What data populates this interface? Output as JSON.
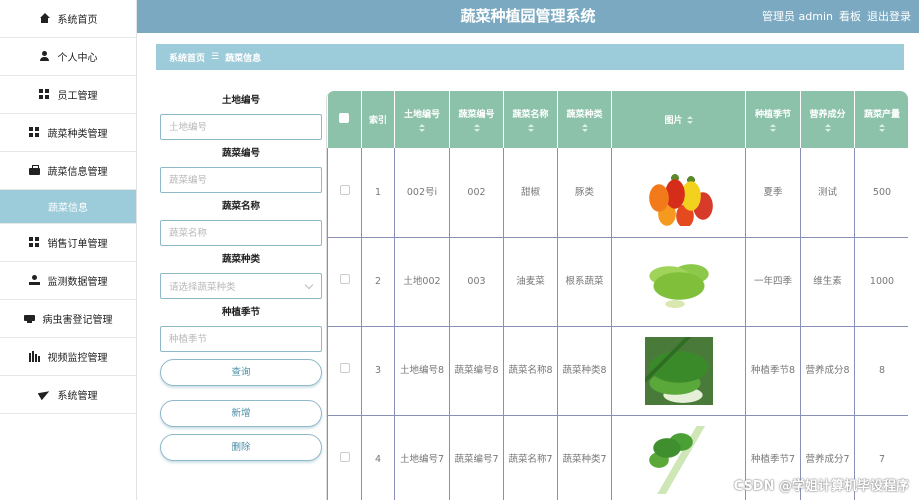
{
  "header": {
    "title": "蔬菜种植园管理系统",
    "user_label": "管理员 admin",
    "dashboard_label": "看板",
    "logout_label": "退出登录"
  },
  "sidebar": {
    "items": [
      {
        "label": "系统首页",
        "icon": "home-icon"
      },
      {
        "label": "个人中心",
        "icon": "user-icon"
      },
      {
        "label": "员工管理",
        "icon": "grid-icon"
      },
      {
        "label": "蔬菜种类管理",
        "icon": "grid-icon"
      },
      {
        "label": "蔬菜信息管理",
        "icon": "briefcase-icon"
      },
      {
        "label": "蔬菜信息",
        "icon": ""
      },
      {
        "label": "销售订单管理",
        "icon": "grid-icon"
      },
      {
        "label": "监测数据管理",
        "icon": "person-icon"
      },
      {
        "label": "病虫害登记管理",
        "icon": "card-icon"
      },
      {
        "label": "视频监控管理",
        "icon": "chart-icon"
      },
      {
        "label": "系统管理",
        "icon": "send-icon"
      }
    ]
  },
  "breadcrumb": {
    "home": "系统首页",
    "separator": "☰",
    "current": "蔬菜信息"
  },
  "search": {
    "land_label": "土地编号",
    "land_placeholder": "土地编号",
    "veg_no_label": "蔬菜编号",
    "veg_no_placeholder": "蔬菜编号",
    "veg_name_label": "蔬菜名称",
    "veg_name_placeholder": "蔬菜名称",
    "veg_type_label": "蔬菜种类",
    "veg_type_placeholder": "请选择蔬菜种类",
    "season_label": "种植季节",
    "season_placeholder": "种植季节",
    "query_button": "查询",
    "add_button": "新增",
    "delete_button": "删除"
  },
  "table": {
    "headers": {
      "index": "索引",
      "land_no": "土地编号",
      "veg_no": "蔬菜编号",
      "veg_name": "蔬菜名称",
      "veg_type": "蔬菜种类",
      "image": "图片",
      "season": "种植季节",
      "nutrition": "营养成分",
      "yield": "蔬菜产量"
    },
    "rows": [
      {
        "index": "1",
        "land_no": "002号i",
        "veg_no": "002",
        "veg_name": "甜椒",
        "veg_type": "豚类",
        "image": "pepper",
        "season": "夏季",
        "nutrition": "测试",
        "yield": "500"
      },
      {
        "index": "2",
        "land_no": "土地002",
        "veg_no": "003",
        "veg_name": "油麦菜",
        "veg_type": "根系蔬菜",
        "image": "lettuce",
        "season": "一年四季",
        "nutrition": "维生素",
        "yield": "1000"
      },
      {
        "index": "3",
        "land_no": "土地编号8",
        "veg_no": "蔬菜编号8",
        "veg_name": "蔬菜名称8",
        "veg_type": "蔬菜种类8",
        "image": "choy",
        "season": "种植季节8",
        "nutrition": "营养成分8",
        "yield": "8"
      },
      {
        "index": "4",
        "land_no": "土地编号7",
        "veg_no": "蔬菜编号7",
        "veg_name": "蔬菜名称7",
        "veg_type": "蔬菜种类7",
        "image": "cilantro",
        "season": "种植季节7",
        "nutrition": "营养成分7",
        "yield": "7"
      }
    ]
  },
  "watermark": "CSDN @学姐计算机毕设程序"
}
